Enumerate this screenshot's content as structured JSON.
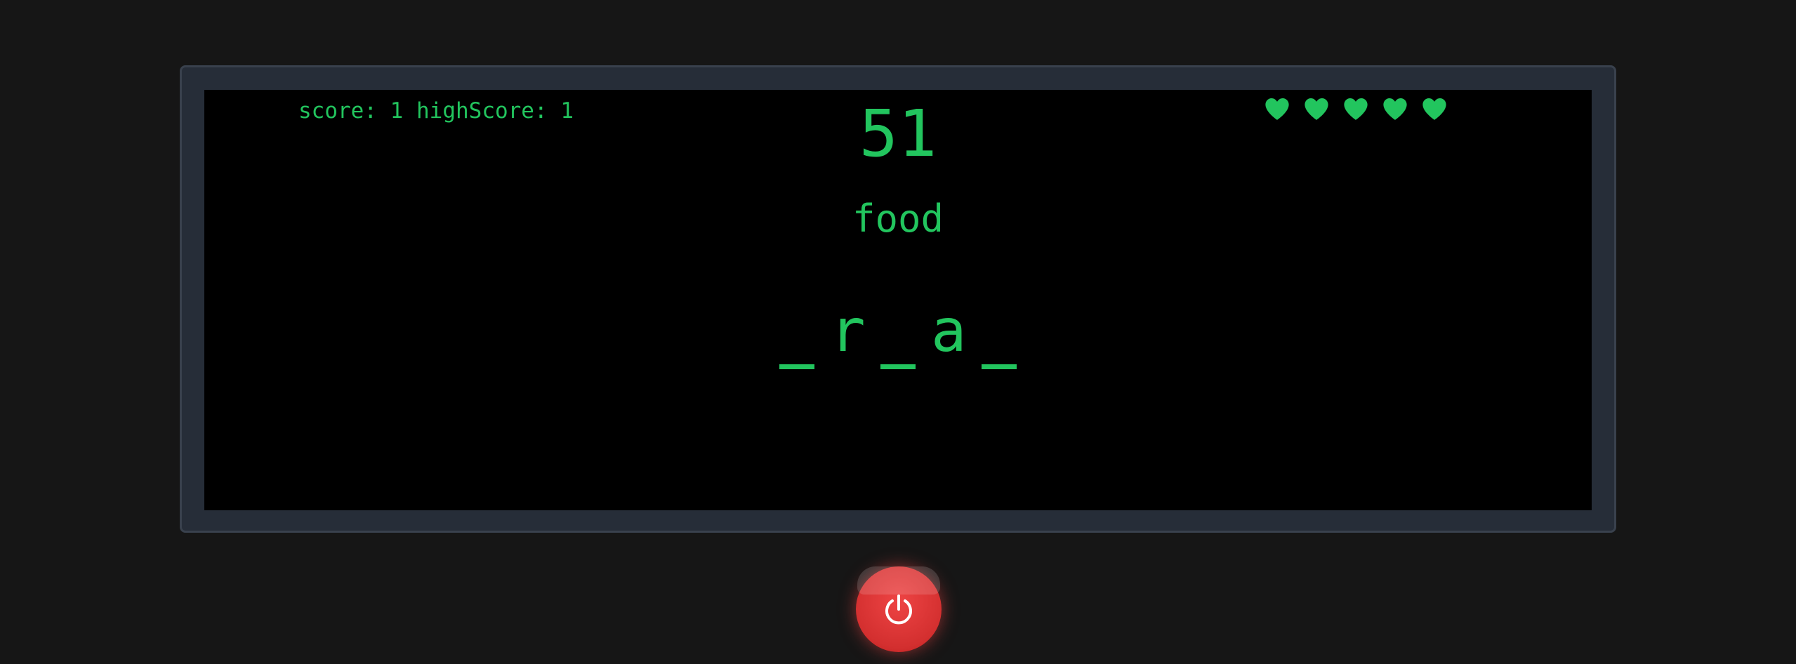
{
  "hud": {
    "score_label": "score:",
    "score_value": "1",
    "highscore_label": "highScore:",
    "highscore_value": "1",
    "timer": "51"
  },
  "lives": {
    "count": 5,
    "icon": "heart-icon"
  },
  "puzzle": {
    "category": "food",
    "letters": [
      "",
      "r",
      "",
      "a",
      ""
    ]
  },
  "controls": {
    "power_icon": "power-icon"
  },
  "colors": {
    "text": "#22c55e",
    "screen": "#000000",
    "bezel": "#262d38",
    "background": "#161616",
    "power_button": "#dc2626"
  }
}
